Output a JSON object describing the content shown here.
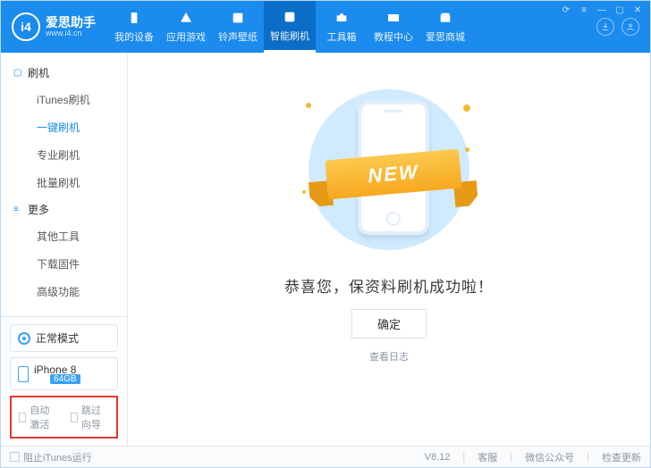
{
  "brand": {
    "name": "爱思助手",
    "site": "www.i4.cn",
    "badge": "i4"
  },
  "nav": [
    {
      "label": "我的设备"
    },
    {
      "label": "应用游戏"
    },
    {
      "label": "铃声壁纸"
    },
    {
      "label": "智能刷机"
    },
    {
      "label": "工具箱"
    },
    {
      "label": "教程中心"
    },
    {
      "label": "爱思商城"
    }
  ],
  "sidebar": {
    "group_flash": {
      "title": "刷机",
      "items": [
        "iTunes刷机",
        "一键刷机",
        "专业刷机",
        "批量刷机"
      ],
      "active_index": 1
    },
    "group_more": {
      "title": "更多",
      "items": [
        "其他工具",
        "下载固件",
        "高级功能"
      ]
    },
    "mode": "正常模式",
    "device": {
      "name": "iPhone 8",
      "storage": "64GB"
    },
    "checks": {
      "auto_activate": "自动激活",
      "skip_guide": "跳过向导"
    }
  },
  "main": {
    "ribbon": "NEW",
    "success_text": "恭喜您，保资料刷机成功啦！",
    "confirm": "确定",
    "view_log": "查看日志"
  },
  "footer": {
    "block_itunes": "阻止iTunes运行",
    "version": "V8.12",
    "support": "客服",
    "wechat": "微信公众号",
    "update": "检查更新"
  }
}
